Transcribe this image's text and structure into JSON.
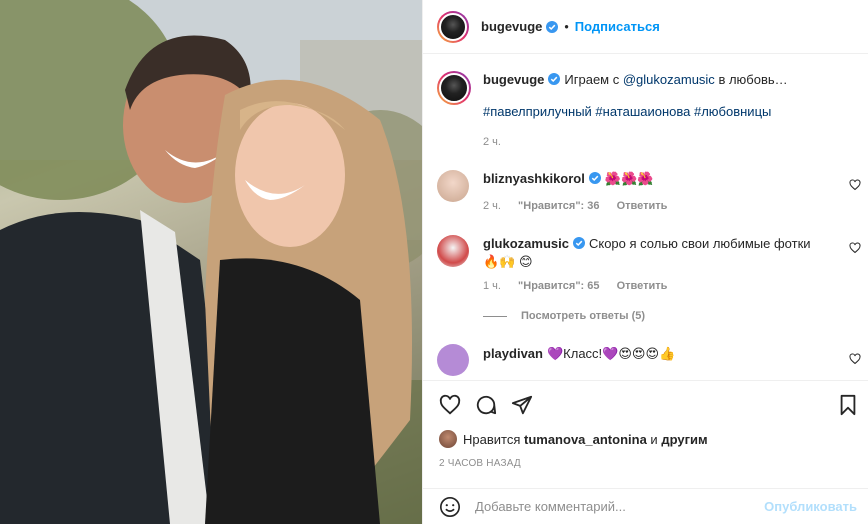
{
  "post": {
    "author": "bugevuge",
    "dot": "•",
    "follow_label": "Подписаться"
  },
  "caption": {
    "author": "bugevuge",
    "text_before": "Играем с",
    "mention": "@glukozamusic",
    "text_after": "в любовь…",
    "hashtags": "#павелприлучный #наташаионова #любовницы",
    "time": "2 ч."
  },
  "comments": [
    {
      "user": "bliznyashkikorol",
      "text": "🌺🌺🌺",
      "time": "2 ч.",
      "likes": "\"Нравится\": 36",
      "reply": "Ответить"
    },
    {
      "user": "glukozamusic",
      "text": "Скоро я солью свои любимые фотки 🔥🙌 😊",
      "time": "1 ч.",
      "likes": "\"Нравится\": 65",
      "reply": "Ответить",
      "view_replies": "Посмотреть ответы (5)"
    },
    {
      "user": "playdivan",
      "text": "💜Класс!💜😍😍😍👍"
    }
  ],
  "likes_line": {
    "prefix": "Нравится",
    "user": "tumanova_antonina",
    "middle": "и",
    "others": "другим"
  },
  "timestamp": "2 ЧАСОВ НАЗАД",
  "add_comment": {
    "placeholder": "Добавьте комментарий...",
    "publish": "Опубликовать"
  },
  "icons": {
    "verified": "verified-badge-icon",
    "heart": "heart-icon",
    "comment": "comment-icon",
    "share": "paper-plane-icon",
    "save": "bookmark-icon",
    "emoji": "smiley-icon"
  },
  "colors": {
    "link": "#0095f6",
    "hashtag": "#00376b",
    "muted": "#8e8e8e",
    "publish_disabled": "#b2dffc"
  }
}
